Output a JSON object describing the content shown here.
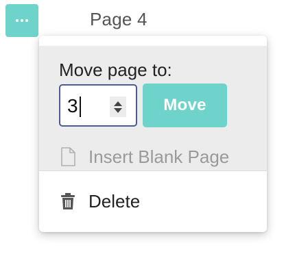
{
  "colors": {
    "accent": "#6dd3cb",
    "input_border": "#4b5a9c",
    "section_bg": "#ececec",
    "disabled_text": "#9a9a9a"
  },
  "header": {
    "more_icon": "ellipsis-icon",
    "page_title": "Page 4"
  },
  "menu": {
    "move": {
      "label": "Move page to:",
      "input_value": "3",
      "button_label": "Move"
    },
    "items": [
      {
        "label": "Insert Blank Page",
        "icon": "blank-page-icon",
        "disabled": true
      },
      {
        "label": "Delete",
        "icon": "trash-icon",
        "disabled": false
      }
    ]
  }
}
